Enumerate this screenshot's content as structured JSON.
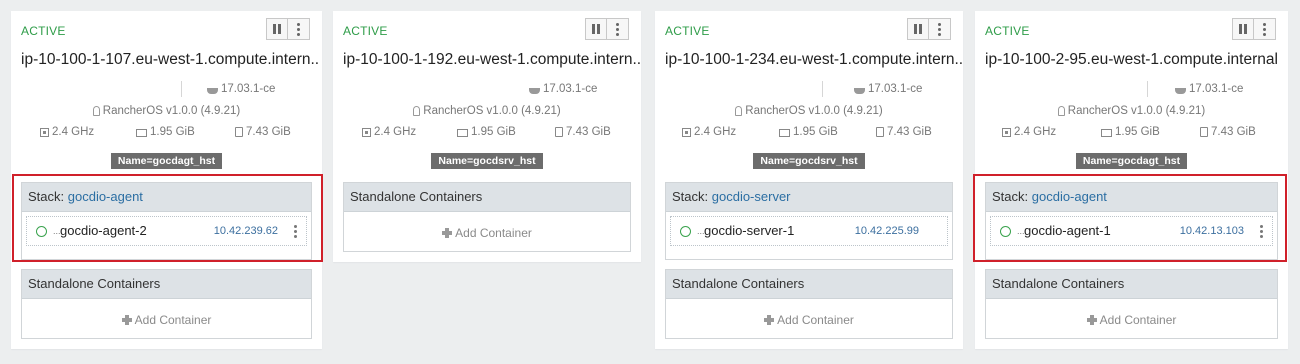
{
  "colors": {
    "active": "#2e9c48",
    "link": "#2b6ea3",
    "highlight": "#d0202a",
    "label_bg": "#6c6c6c",
    "section_head": "#dde2e6"
  },
  "icons": {
    "pause": "pause-icon",
    "more": "kebab-icon",
    "docker": "whale-icon",
    "os": "linux-icon",
    "cpu": "cpu-icon",
    "memory": "memory-icon",
    "storage": "disk-icon",
    "status": "circle-icon",
    "add": "plus-icon"
  },
  "hosts": [
    {
      "state": "ACTIVE",
      "hostname": "ip-10-100-1-107.eu-west-1.compute.intern..",
      "docker": "17.03.1-ce",
      "os": "RancherOS v1.0.0 (4.9.21)",
      "cpu": "2.4 GHz",
      "memory": "1.95 GiB",
      "storage": "7.43 GiB",
      "label": "Name=gocdagt_hst",
      "stack": {
        "prefix": "Stack: ",
        "name": "gocdio-agent",
        "containers": [
          {
            "ellipsis": "...",
            "name": "gocdio-agent-2",
            "ip": "10.42.239.62"
          }
        ]
      },
      "standalone": {
        "title": "Standalone Containers",
        "add": "Add Container"
      }
    },
    {
      "state": "ACTIVE",
      "hostname": "ip-10-100-1-192.eu-west-1.compute.intern..",
      "docker": "17.03.1-ce",
      "os": "RancherOS v1.0.0 (4.9.21)",
      "cpu": "2.4 GHz",
      "memory": "1.95 GiB",
      "storage": "7.43 GiB",
      "label": "Name=gocdsrv_hst",
      "standalone": {
        "title": "Standalone Containers",
        "add": "Add Container"
      }
    },
    {
      "state": "ACTIVE",
      "hostname": "ip-10-100-1-234.eu-west-1.compute.intern..",
      "docker": "17.03.1-ce",
      "os": "RancherOS v1.0.0 (4.9.21)",
      "cpu": "2.4 GHz",
      "memory": "1.95 GiB",
      "storage": "7.43 GiB",
      "label": "Name=gocdsrv_hst",
      "stack": {
        "prefix": "Stack: ",
        "name": "gocdio-server",
        "containers": [
          {
            "ellipsis": "...",
            "name": "gocdio-server-1",
            "ip": "10.42.225.99"
          }
        ]
      },
      "standalone": {
        "title": "Standalone Containers",
        "add": "Add Container"
      }
    },
    {
      "state": "ACTIVE",
      "hostname": "ip-10-100-2-95.eu-west-1.compute.internal",
      "docker": "17.03.1-ce",
      "os": "RancherOS v1.0.0 (4.9.21)",
      "cpu": "2.4 GHz",
      "memory": "1.95 GiB",
      "storage": "7.43 GiB",
      "label": "Name=gocdagt_hst",
      "stack": {
        "prefix": "Stack: ",
        "name": "gocdio-agent",
        "containers": [
          {
            "ellipsis": "...",
            "name": "gocdio-agent-1",
            "ip": "10.42.13.103"
          }
        ]
      },
      "standalone": {
        "title": "Standalone Containers",
        "add": "Add Container"
      }
    }
  ]
}
